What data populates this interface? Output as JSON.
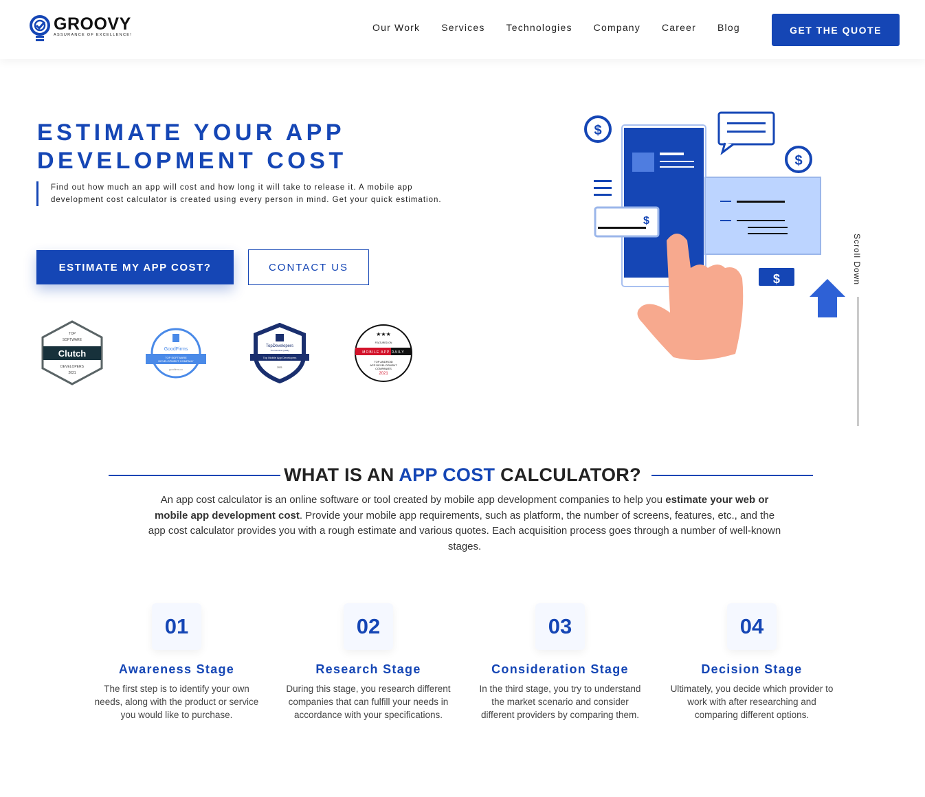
{
  "header": {
    "logo_name": "GROOVY",
    "logo_tagline": "ASSURANCE OF EXCELLENCE!",
    "nav": [
      "Our Work",
      "Services",
      "Technologies",
      "Company",
      "Career",
      "Blog"
    ],
    "cta": "GET THE QUOTE"
  },
  "hero": {
    "title_line1": "ESTIMATE YOUR APP",
    "title_line2": "DEVELOPMENT COST",
    "description": "Find out how much an app will cost and how long it will take to release it. A mobile app development cost calculator is created using every person in mind. Get your quick estimation.",
    "primary_button": "ESTIMATE MY APP COST?",
    "secondary_button": "CONTACT US",
    "badges": [
      {
        "name": "Clutch",
        "text": [
          "TOP",
          "SOFTWARE",
          "Clutch",
          "DEVELOPERS",
          "2021"
        ]
      },
      {
        "name": "GoodFirms",
        "text": [
          "GoodFirms",
          "TOP SOFTWARE",
          "DEVELOPMENT COMPANY",
          "goodfirms.co"
        ]
      },
      {
        "name": "TopDevelopers",
        "text": [
          "TopDevelopers",
          "The Genuine Quality",
          "Top Mobile App Developers",
          "2021"
        ]
      },
      {
        "name": "Mobile App Daily",
        "text": [
          "FEATURED ON",
          "MOBILE APP DAILY",
          "TOP ANDROID",
          "APP DEVELOPMENT",
          "COMPANIES",
          "2021"
        ]
      }
    ],
    "scroll_label": "Scroll Down"
  },
  "section": {
    "title_pre": "WHAT IS AN ",
    "title_highlight": "APP COST",
    "title_post": " CALCULATOR?",
    "desc_1": "An app cost calculator is an online software or tool created by mobile app development companies to help you ",
    "desc_bold": "estimate your web or mobile app development cost",
    "desc_2": ". Provide your mobile app requirements, such as platform, the number of screens, features, etc., and the app cost calculator provides you with a rough estimate and various quotes. Each acquisition process goes through a number of well-known stages."
  },
  "stages": [
    {
      "num": "01",
      "title": "Awareness Stage",
      "text": "The first step is to identify your own needs, along with the product or service you would like to purchase."
    },
    {
      "num": "02",
      "title": "Research Stage",
      "text": "During this stage, you research different companies that can fulfill your needs in accordance with your specifications."
    },
    {
      "num": "03",
      "title": "Consideration Stage",
      "text": "In the third stage, you try to understand the market scenario and consider different providers by comparing them."
    },
    {
      "num": "04",
      "title": "Decision Stage",
      "text": "Ultimately, you decide which provider to work with after researching and comparing different options."
    }
  ],
  "colors": {
    "accent": "#1546b5",
    "skin": "#f7a98e"
  }
}
